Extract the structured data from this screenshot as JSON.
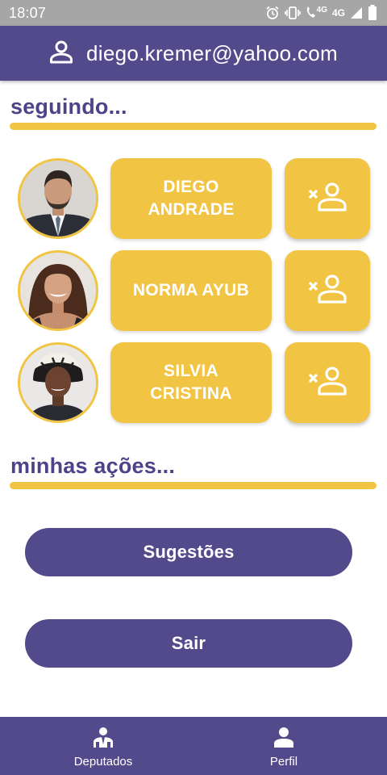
{
  "status_bar": {
    "time": "18:07",
    "network_small": "4G",
    "network_big": "4G",
    "icons": [
      "alarm-icon",
      "vibrate-icon",
      "wifi-calling-icon",
      "signal-icon",
      "battery-icon"
    ]
  },
  "header": {
    "email": "diego.kremer@yahoo.com",
    "icon": "user-icon"
  },
  "following": {
    "title": "seguindo...",
    "deputies": [
      {
        "name": "DIEGO ANDRADE",
        "unfollow_icon": "remove-user-icon"
      },
      {
        "name": "NORMA AYUB",
        "unfollow_icon": "remove-user-icon"
      },
      {
        "name": "SILVIA CRISTINA",
        "unfollow_icon": "remove-user-icon"
      }
    ]
  },
  "actions": {
    "title": "minhas ações...",
    "suggestions_label": "Sugestões",
    "logout_label": "Sair"
  },
  "bottom_nav": {
    "items": [
      {
        "label": "Deputados",
        "icon": "deputies-icon"
      },
      {
        "label": "Perfil",
        "icon": "profile-icon"
      }
    ]
  },
  "colors": {
    "primary": "#534a8b",
    "accent": "#f2c443",
    "title_text": "#4c4389",
    "status_bar": "#a6a6a6"
  }
}
